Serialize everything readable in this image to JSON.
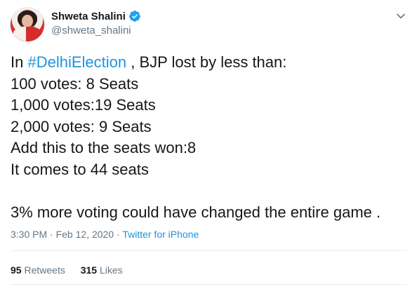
{
  "user": {
    "display_name": "Shweta Shalini",
    "handle": "@shweta_shalini"
  },
  "tweet": {
    "prefix": "In ",
    "hashtag": "#DelhiElection",
    "after_hashtag": " , BJP lost by less than:",
    "lines": [
      "100 votes: 8 Seats",
      "1,000 votes:19 Seats",
      "2,000 votes: 9 Seats",
      "Add this to the seats won:8",
      "It comes to 44 seats",
      "",
      "3% more voting could have changed the entire game ."
    ]
  },
  "meta": {
    "time": "3:30 PM",
    "separator": " · ",
    "date": "Feb 12, 2020",
    "source": "Twitter for iPhone"
  },
  "stats": {
    "retweets_count": "95",
    "retweets_label": "Retweets",
    "likes_count": "315",
    "likes_label": "Likes"
  },
  "colors": {
    "link": "#1b95e0",
    "muted": "#657786",
    "text": "#14171a",
    "verified": "#1da1f2"
  },
  "icons": [
    "verified-badge-icon",
    "chevron-down-icon"
  ]
}
